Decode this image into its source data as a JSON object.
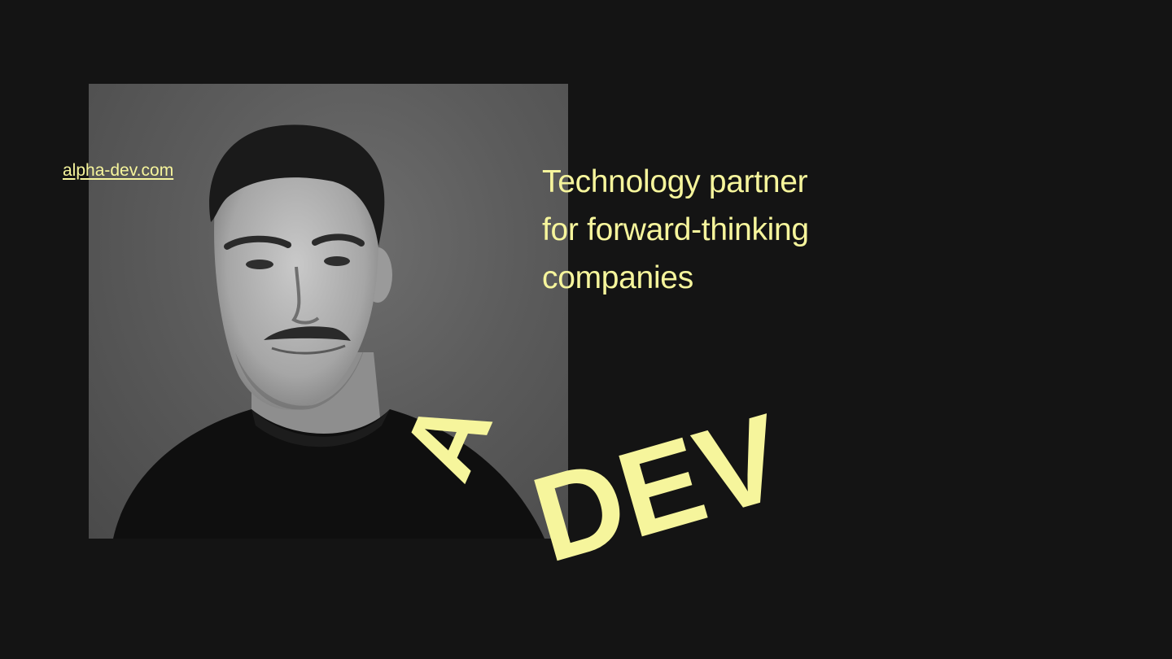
{
  "site_link": {
    "label": "alpha-dev.com"
  },
  "tagline": {
    "lines": [
      "Technology partner",
      "for forward-thinking",
      "companies"
    ]
  },
  "logo": {
    "letter_a": "A",
    "letters_dev": "DEV"
  },
  "colors": {
    "background": "#141414",
    "accent": "#f6f59c",
    "photo_backdrop": "#5c5c5c"
  }
}
